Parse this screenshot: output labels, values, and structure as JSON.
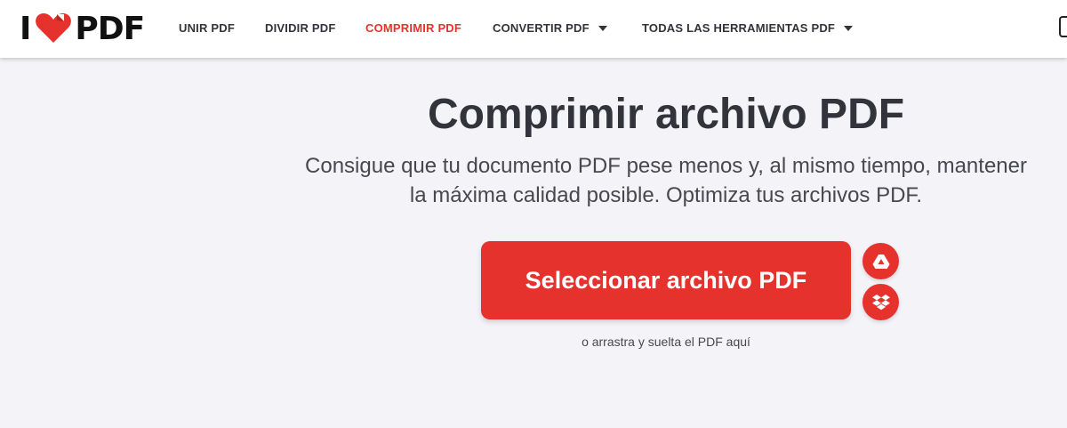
{
  "header": {
    "logo": {
      "prefix": "I",
      "text": "PDF"
    },
    "nav": [
      {
        "label": "UNIR PDF"
      },
      {
        "label": "DIVIDIR PDF"
      },
      {
        "label": "COMPRIMIR PDF",
        "active": true
      },
      {
        "label": "CONVERTIR PDF",
        "dropdown": true
      },
      {
        "label": "TODAS LAS HERRAMIENTAS PDF",
        "dropdown": true
      }
    ]
  },
  "main": {
    "title": "Comprimir archivo PDF",
    "subtitle_line1": "Consigue que tu documento PDF pese menos y, al mismo tiempo, mantener",
    "subtitle_line2": "la máxima calidad posible. Optimiza tus archivos PDF.",
    "select_button": "Seleccionar archivo PDF",
    "cloud_buttons": [
      {
        "icon": "google-drive-icon"
      },
      {
        "icon": "dropbox-icon"
      }
    ],
    "drop_hint": "o arrastra y suelta el PDF aquí"
  },
  "colors": {
    "accent": "#e5322d",
    "text": "#33333b",
    "background": "#f4f4f8"
  }
}
